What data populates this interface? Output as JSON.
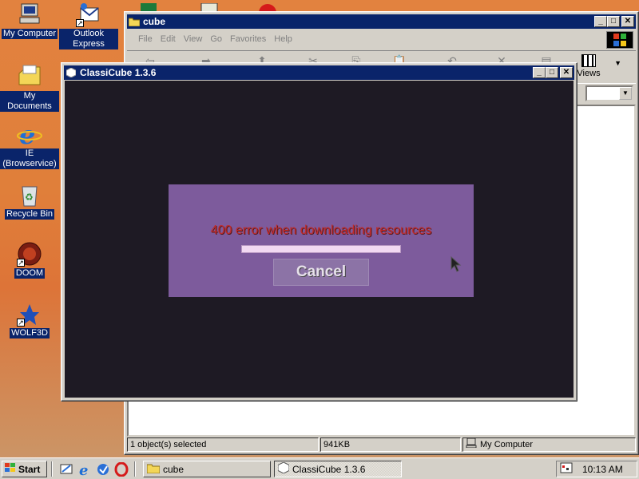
{
  "desktop": {
    "icons": [
      {
        "label": "My Computer",
        "icon": "my-computer-icon"
      },
      {
        "label": "Outlook Express",
        "icon": "outlook-express-icon"
      },
      {
        "label": "My Documents",
        "icon": "my-documents-icon"
      },
      {
        "label": "IE (Browservice)",
        "icon": "internet-explorer-icon"
      },
      {
        "label": "Recycle Bin",
        "icon": "recycle-bin-icon"
      },
      {
        "label": "DOOM",
        "icon": "doom-icon"
      },
      {
        "label": "WOLF3D",
        "icon": "wolf3d-icon"
      }
    ]
  },
  "explorer": {
    "title": "cube",
    "menu": [
      "File",
      "Edit",
      "View",
      "Go",
      "Favorites",
      "Help"
    ],
    "toolbar_views_label": "Views",
    "status": {
      "selection": "1 object(s) selected",
      "size": "941KB",
      "zone": "My Computer"
    }
  },
  "game": {
    "title": "ClassiCube 1.3.6",
    "message": "400 error when downloading resources",
    "progress": 1.0,
    "cancel_label": "Cancel"
  },
  "taskbar": {
    "start_label": "Start",
    "tasks": [
      {
        "label": "cube",
        "active": false
      },
      {
        "label": "ClassiCube 1.3.6",
        "active": true
      }
    ],
    "clock": "10:13 AM"
  },
  "colors": {
    "active_title": "#0a246a",
    "dialog_bg": "#7d5b9c",
    "error_text": "#c12a2a"
  }
}
